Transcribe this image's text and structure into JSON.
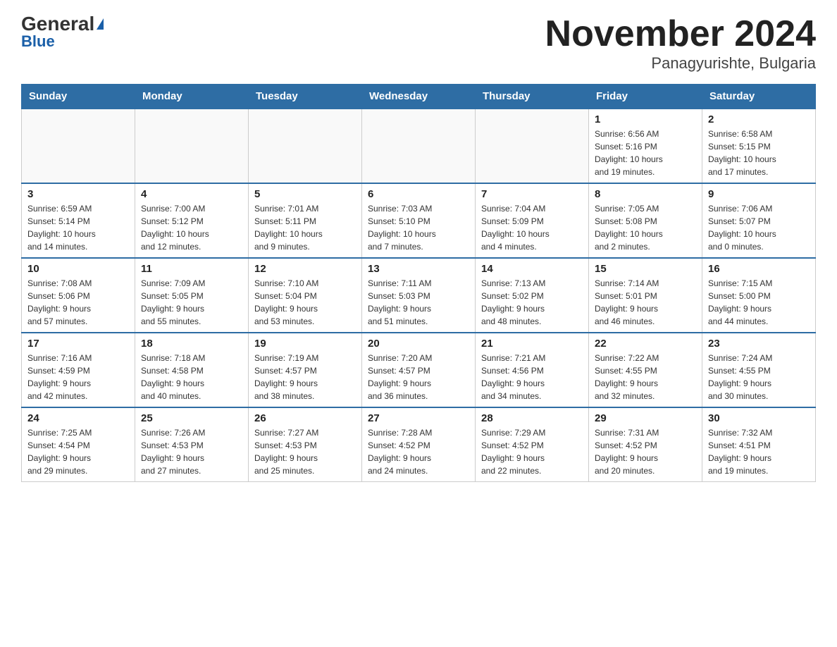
{
  "header": {
    "logo_general": "General",
    "logo_blue": "Blue",
    "title": "November 2024",
    "subtitle": "Panagyurishte, Bulgaria"
  },
  "weekdays": [
    "Sunday",
    "Monday",
    "Tuesday",
    "Wednesday",
    "Thursday",
    "Friday",
    "Saturday"
  ],
  "weeks": [
    [
      {
        "day": "",
        "info": ""
      },
      {
        "day": "",
        "info": ""
      },
      {
        "day": "",
        "info": ""
      },
      {
        "day": "",
        "info": ""
      },
      {
        "day": "",
        "info": ""
      },
      {
        "day": "1",
        "info": "Sunrise: 6:56 AM\nSunset: 5:16 PM\nDaylight: 10 hours\nand 19 minutes."
      },
      {
        "day": "2",
        "info": "Sunrise: 6:58 AM\nSunset: 5:15 PM\nDaylight: 10 hours\nand 17 minutes."
      }
    ],
    [
      {
        "day": "3",
        "info": "Sunrise: 6:59 AM\nSunset: 5:14 PM\nDaylight: 10 hours\nand 14 minutes."
      },
      {
        "day": "4",
        "info": "Sunrise: 7:00 AM\nSunset: 5:12 PM\nDaylight: 10 hours\nand 12 minutes."
      },
      {
        "day": "5",
        "info": "Sunrise: 7:01 AM\nSunset: 5:11 PM\nDaylight: 10 hours\nand 9 minutes."
      },
      {
        "day": "6",
        "info": "Sunrise: 7:03 AM\nSunset: 5:10 PM\nDaylight: 10 hours\nand 7 minutes."
      },
      {
        "day": "7",
        "info": "Sunrise: 7:04 AM\nSunset: 5:09 PM\nDaylight: 10 hours\nand 4 minutes."
      },
      {
        "day": "8",
        "info": "Sunrise: 7:05 AM\nSunset: 5:08 PM\nDaylight: 10 hours\nand 2 minutes."
      },
      {
        "day": "9",
        "info": "Sunrise: 7:06 AM\nSunset: 5:07 PM\nDaylight: 10 hours\nand 0 minutes."
      }
    ],
    [
      {
        "day": "10",
        "info": "Sunrise: 7:08 AM\nSunset: 5:06 PM\nDaylight: 9 hours\nand 57 minutes."
      },
      {
        "day": "11",
        "info": "Sunrise: 7:09 AM\nSunset: 5:05 PM\nDaylight: 9 hours\nand 55 minutes."
      },
      {
        "day": "12",
        "info": "Sunrise: 7:10 AM\nSunset: 5:04 PM\nDaylight: 9 hours\nand 53 minutes."
      },
      {
        "day": "13",
        "info": "Sunrise: 7:11 AM\nSunset: 5:03 PM\nDaylight: 9 hours\nand 51 minutes."
      },
      {
        "day": "14",
        "info": "Sunrise: 7:13 AM\nSunset: 5:02 PM\nDaylight: 9 hours\nand 48 minutes."
      },
      {
        "day": "15",
        "info": "Sunrise: 7:14 AM\nSunset: 5:01 PM\nDaylight: 9 hours\nand 46 minutes."
      },
      {
        "day": "16",
        "info": "Sunrise: 7:15 AM\nSunset: 5:00 PM\nDaylight: 9 hours\nand 44 minutes."
      }
    ],
    [
      {
        "day": "17",
        "info": "Sunrise: 7:16 AM\nSunset: 4:59 PM\nDaylight: 9 hours\nand 42 minutes."
      },
      {
        "day": "18",
        "info": "Sunrise: 7:18 AM\nSunset: 4:58 PM\nDaylight: 9 hours\nand 40 minutes."
      },
      {
        "day": "19",
        "info": "Sunrise: 7:19 AM\nSunset: 4:57 PM\nDaylight: 9 hours\nand 38 minutes."
      },
      {
        "day": "20",
        "info": "Sunrise: 7:20 AM\nSunset: 4:57 PM\nDaylight: 9 hours\nand 36 minutes."
      },
      {
        "day": "21",
        "info": "Sunrise: 7:21 AM\nSunset: 4:56 PM\nDaylight: 9 hours\nand 34 minutes."
      },
      {
        "day": "22",
        "info": "Sunrise: 7:22 AM\nSunset: 4:55 PM\nDaylight: 9 hours\nand 32 minutes."
      },
      {
        "day": "23",
        "info": "Sunrise: 7:24 AM\nSunset: 4:55 PM\nDaylight: 9 hours\nand 30 minutes."
      }
    ],
    [
      {
        "day": "24",
        "info": "Sunrise: 7:25 AM\nSunset: 4:54 PM\nDaylight: 9 hours\nand 29 minutes."
      },
      {
        "day": "25",
        "info": "Sunrise: 7:26 AM\nSunset: 4:53 PM\nDaylight: 9 hours\nand 27 minutes."
      },
      {
        "day": "26",
        "info": "Sunrise: 7:27 AM\nSunset: 4:53 PM\nDaylight: 9 hours\nand 25 minutes."
      },
      {
        "day": "27",
        "info": "Sunrise: 7:28 AM\nSunset: 4:52 PM\nDaylight: 9 hours\nand 24 minutes."
      },
      {
        "day": "28",
        "info": "Sunrise: 7:29 AM\nSunset: 4:52 PM\nDaylight: 9 hours\nand 22 minutes."
      },
      {
        "day": "29",
        "info": "Sunrise: 7:31 AM\nSunset: 4:52 PM\nDaylight: 9 hours\nand 20 minutes."
      },
      {
        "day": "30",
        "info": "Sunrise: 7:32 AM\nSunset: 4:51 PM\nDaylight: 9 hours\nand 19 minutes."
      }
    ]
  ]
}
